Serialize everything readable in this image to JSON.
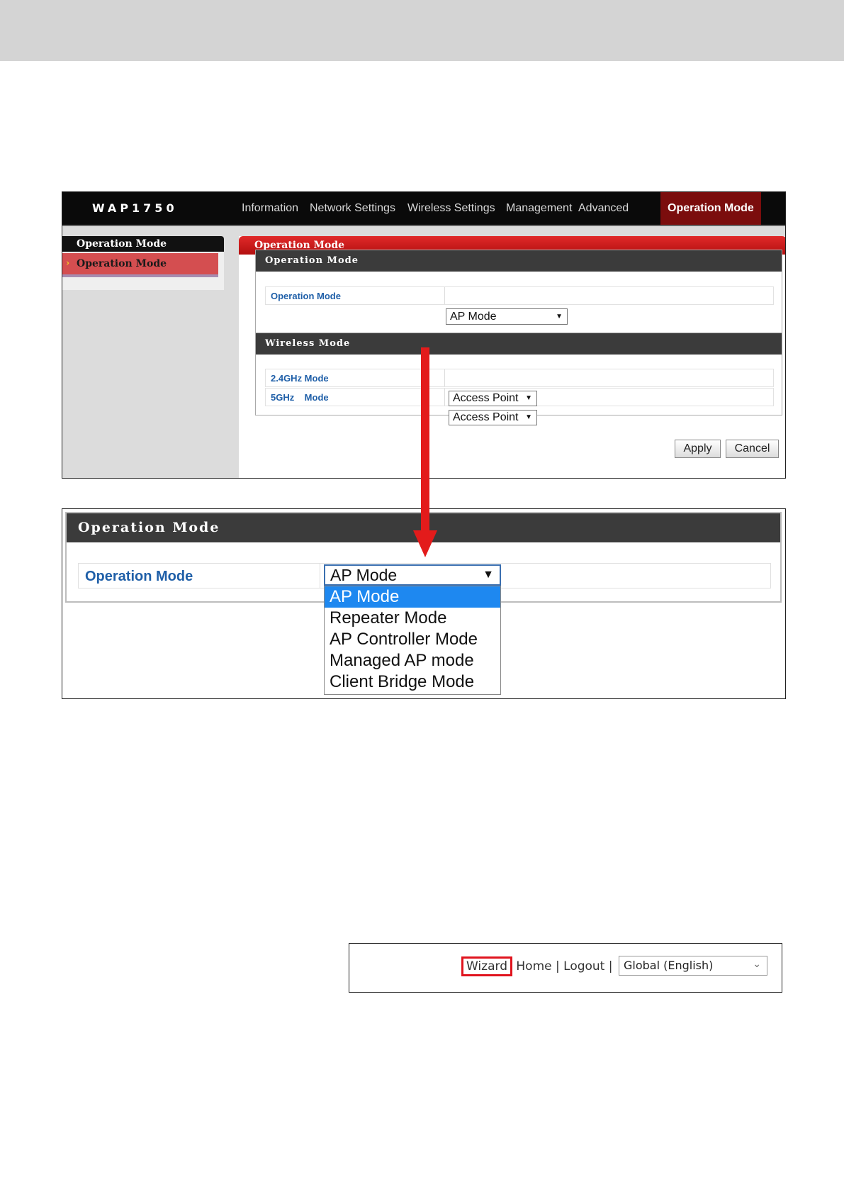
{
  "device": {
    "brand": "WAP1750"
  },
  "nav": {
    "items": [
      "Information",
      "Network Settings",
      "Wireless Settings",
      "Management",
      "Advanced",
      "Operation Mode"
    ],
    "active": "Operation Mode"
  },
  "sidebar": {
    "header": "Operation Mode",
    "items": [
      "Operation Mode"
    ]
  },
  "content": {
    "title": "Operation Mode"
  },
  "operation_panel": {
    "title": "Operation Mode",
    "label": "Operation Mode",
    "value": "AP Mode"
  },
  "wireless_panel": {
    "title": "Wireless Mode",
    "rows": [
      {
        "label": "2.4GHz Mode",
        "value": "Access Point"
      },
      {
        "label": "5GHz    Mode",
        "value": "Access Point"
      }
    ]
  },
  "buttons": {
    "apply": "Apply",
    "cancel": "Cancel"
  },
  "zoom_panel": {
    "title": "Operation Mode",
    "label": "Operation Mode",
    "value": "AP Mode",
    "options": [
      "AP Mode",
      "Repeater Mode",
      "AP Controller Mode",
      "Managed AP mode",
      "Client Bridge Mode"
    ],
    "selected": "AP Mode"
  },
  "top_links": {
    "wizard": "Wizard",
    "home": "Home",
    "logout": "Logout",
    "separator": "|",
    "language": "Global (English)"
  },
  "colors": {
    "accent_red": "#e31b1b",
    "nav_active": "#7b0d0d",
    "label_blue": "#1f5fa8",
    "dropdown_highlight": "#1e88f0"
  }
}
